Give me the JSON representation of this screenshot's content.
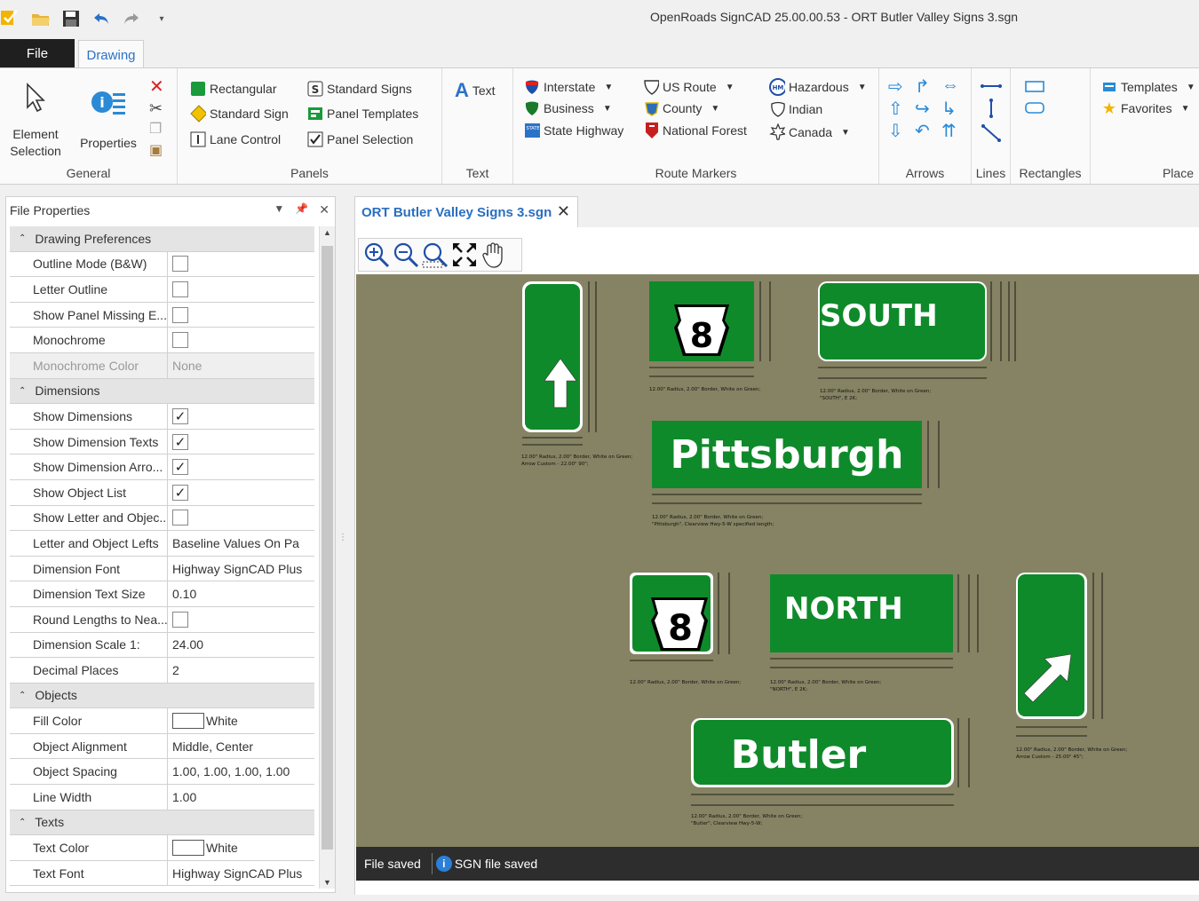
{
  "window": {
    "title": "OpenRoads SignCAD 25.00.00.53 - ORT Butler Valley Signs 3.sgn"
  },
  "tabs": {
    "file": "File",
    "drawing": "Drawing"
  },
  "ribbon": {
    "general": {
      "label": "General",
      "element_selection": "Element Selection",
      "properties": "Properties"
    },
    "panels": {
      "label": "Panels",
      "rectangular": "Rectangular",
      "standard_sign": "Standard Sign",
      "lane_control": "Lane Control",
      "standard_signs": "Standard Signs",
      "panel_templates": "Panel Templates",
      "panel_selection": "Panel Selection"
    },
    "text": {
      "label": "Text",
      "text_button": "Text"
    },
    "route_markers": {
      "label": "Route Markers",
      "interstate": "Interstate",
      "business": "Business",
      "state_highway": "State Highway",
      "us_route": "US Route",
      "county": "County",
      "national_forest": "National Forest",
      "hazardous": "Hazardous",
      "indian": "Indian",
      "canada": "Canada"
    },
    "arrows": {
      "label": "Arrows"
    },
    "lines": {
      "label": "Lines"
    },
    "rectangles": {
      "label": "Rectangles"
    },
    "place": {
      "label": "Place",
      "templates": "Templates",
      "favorites": "Favorites"
    }
  },
  "file_properties": {
    "title": "File Properties",
    "categories": {
      "drawing_preferences": "Drawing Preferences",
      "dimensions": "Dimensions",
      "objects": "Objects",
      "texts": "Texts"
    },
    "rows": {
      "outline_mode": {
        "name": "Outline Mode (B&W)",
        "checked": false
      },
      "letter_outline": {
        "name": "Letter Outline",
        "checked": false
      },
      "show_panel_missing": {
        "name": "Show Panel Missing E...",
        "checked": false
      },
      "monochrome": {
        "name": "Monochrome",
        "checked": false
      },
      "monochrome_color": {
        "name": "Monochrome Color",
        "value": "None"
      },
      "show_dimensions": {
        "name": "Show Dimensions",
        "checked": true
      },
      "show_dimension_texts": {
        "name": "Show Dimension Texts",
        "checked": true
      },
      "show_dimension_arrows": {
        "name": "Show Dimension Arro...",
        "checked": true
      },
      "show_object_list": {
        "name": "Show Object List",
        "checked": true
      },
      "show_letter_object": {
        "name": "Show Letter and Objec...",
        "checked": false
      },
      "letter_object_lefts": {
        "name": "Letter and Object Lefts",
        "value": "Baseline Values On Pa"
      },
      "dimension_font": {
        "name": "Dimension Font",
        "value": "Highway SignCAD Plus"
      },
      "dimension_text_size": {
        "name": "Dimension Text Size",
        "value": "0.10"
      },
      "round_lengths": {
        "name": "Round Lengths to Nea...",
        "checked": false
      },
      "dimension_scale": {
        "name": "Dimension Scale 1:",
        "value": "24.00"
      },
      "decimal_places": {
        "name": "Decimal Places",
        "value": "2"
      },
      "fill_color": {
        "name": "Fill Color",
        "value": "White"
      },
      "object_alignment": {
        "name": "Object Alignment",
        "value": "Middle, Center"
      },
      "object_spacing": {
        "name": "Object Spacing",
        "value": "1.00, 1.00, 1.00, 1.00"
      },
      "line_width": {
        "name": "Line Width",
        "value": "1.00"
      },
      "text_color": {
        "name": "Text Color",
        "value": "White"
      },
      "text_font": {
        "name": "Text Font",
        "value": "Highway SignCAD Plus"
      }
    }
  },
  "document": {
    "tab_label": "ORT Butler Valley Signs 3.sgn"
  },
  "signs": {
    "south": "SOUTH",
    "pittsburgh": "Pittsburgh",
    "north": "NORTH",
    "butler": "Butler",
    "route_number": "8",
    "note_arrow1_a": "12.00\" Radius, 2.00\" Border, White on Green;",
    "note_arrow1_b": "Arrow Custom - 22.00\" 90\";",
    "note_shield": "12.00\" Radius, 2.00\" Border, White on Green;",
    "note_south_a": "12.00\" Radius, 2.00\" Border, White on Green;",
    "note_south_b": "\"SOUTH\", E 2K;",
    "note_pitt_a": "12.00\" Radius, 2.00\" Border, White on Green;",
    "note_pitt_b": "\"Pittsburgh\", Clearview Hwy-5-W specified length;",
    "note_north_a": "12.00\" Radius, 2.00\" Border, White on Green;",
    "note_north_b": "\"NORTH\", E 2K;",
    "note_arrow2_a": "12.00\" Radius, 2.00\" Border, White on Green;",
    "note_arrow2_b": "Arrow Custom - 25.00\" 45\";",
    "note_butler_a": "12.00\" Radius, 2.00\" Border, White on Green;",
    "note_butler_b": "\"Butler\", Clearview Hwy-5-W;"
  },
  "status": {
    "left": "File saved",
    "right": "SGN file saved"
  },
  "colors": {
    "sign_green": "#0f8a2a",
    "canvas": "#858363",
    "accent": "#2a72c8"
  }
}
